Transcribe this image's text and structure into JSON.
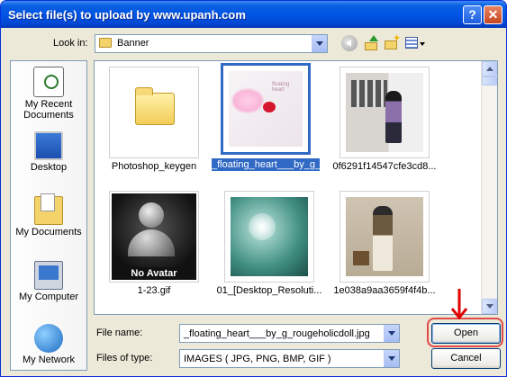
{
  "window": {
    "title": "Select file(s) to upload by www.upanh.com"
  },
  "title_buttons": {
    "help": "?",
    "close": "✕"
  },
  "lookin": {
    "label": "Look in:",
    "value": "Banner"
  },
  "places": [
    {
      "label": "My Recent Documents",
      "icon": "recent-documents-icon"
    },
    {
      "label": "Desktop",
      "icon": "desktop-icon"
    },
    {
      "label": "My Documents",
      "icon": "my-documents-icon"
    },
    {
      "label": "My Computer",
      "icon": "my-computer-icon"
    },
    {
      "label": "My Network",
      "icon": "my-network-icon"
    }
  ],
  "files": [
    {
      "name": "Photoshop_keygen",
      "kind": "folder"
    },
    {
      "name": "_floating_heart___by_g_rougeholicdoll.jpg",
      "kind": "image",
      "selected": true,
      "hearts_caption": "floating heart"
    },
    {
      "name": "0f6291f14547cfe3cd8...",
      "kind": "image"
    },
    {
      "name": "1-23.gif",
      "kind": "image",
      "overlay": "No Avatar"
    },
    {
      "name": "01_[Desktop_Resoluti...",
      "kind": "image"
    },
    {
      "name": "1e038a9aa3659f4f4b...",
      "kind": "image"
    }
  ],
  "filename": {
    "label": "File name:",
    "value": "_floating_heart___by_g_rougeholicdoll.jpg"
  },
  "filetype": {
    "label": "Files of type:",
    "value": "IMAGES ( JPG, PNG, BMP, GIF )"
  },
  "buttons": {
    "open": "Open",
    "cancel": "Cancel"
  },
  "colors": {
    "titlebar": "#0055e5",
    "selection": "#316ac5",
    "annotation": "#e04a4a"
  }
}
